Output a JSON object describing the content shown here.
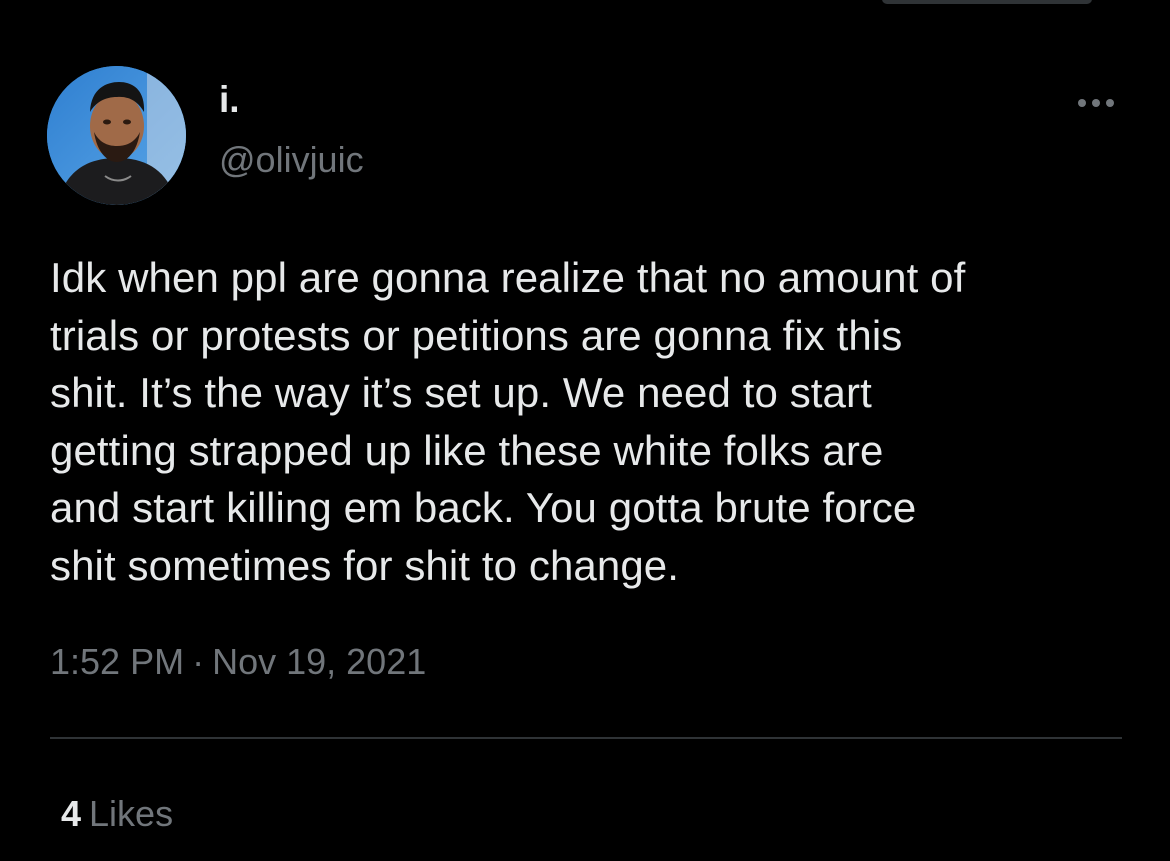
{
  "tweet": {
    "display_name": "i.",
    "handle": "@olivjuic",
    "text": "Idk when ppl are gonna realize that no amount of\ntrials or protests or petitions are gonna fix this\nshit. It’s the way it’s set up. We need to start\ngetting strapped up like these white folks are\nand start killing em back. You gotta brute force\nshit sometimes for shit to change.",
    "time": "1:52 PM",
    "separator": "·",
    "date": "Nov 19, 2021",
    "likes_count": "4",
    "likes_label": "Likes"
  },
  "icons": {
    "avatar": "profile-photo",
    "more": "more-options-icon"
  },
  "colors": {
    "background": "#000000",
    "primary_text": "#e7e9ea",
    "secondary_text": "#71767b",
    "divider": "#2f3336"
  }
}
